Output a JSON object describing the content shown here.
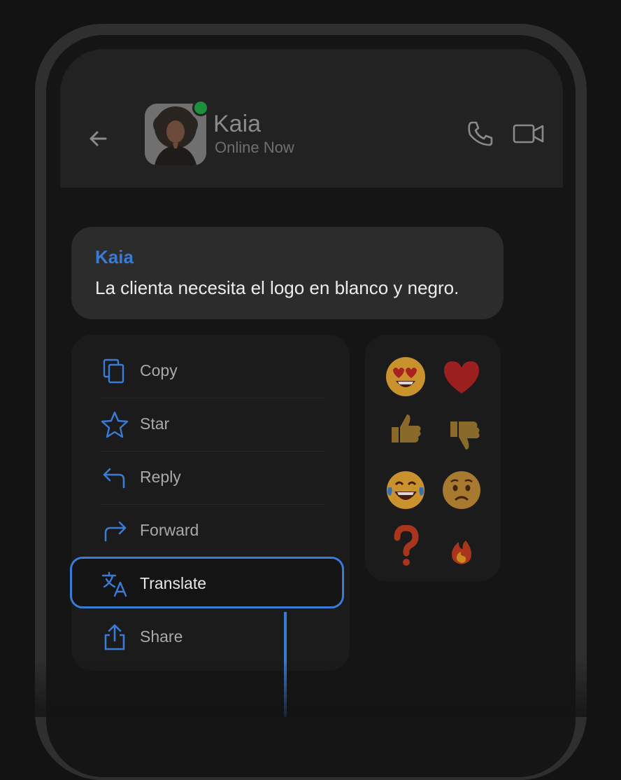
{
  "header": {
    "contact_name": "Kaia",
    "status": "Online Now"
  },
  "message": {
    "sender": "Kaia",
    "text": "La clienta necesita el logo en blanco y negro."
  },
  "menu": {
    "items": [
      {
        "label": "Copy",
        "icon": "copy-icon"
      },
      {
        "label": "Star",
        "icon": "star-icon"
      },
      {
        "label": "Reply",
        "icon": "reply-icon"
      },
      {
        "label": "Forward",
        "icon": "forward-icon"
      },
      {
        "label": "Translate",
        "icon": "translate-icon",
        "highlighted": true
      },
      {
        "label": "Share",
        "icon": "share-icon"
      }
    ]
  },
  "reactions": [
    "heart-eyes-emoji",
    "red-heart-emoji",
    "thumbs-up-emoji",
    "thumbs-down-emoji",
    "tears-of-joy-emoji",
    "worried-emoji",
    "question-mark-emoji",
    "fire-emoji"
  ],
  "colors": {
    "accent": "#3a7bd5",
    "online": "#1e8f3c",
    "background": "#131313"
  }
}
